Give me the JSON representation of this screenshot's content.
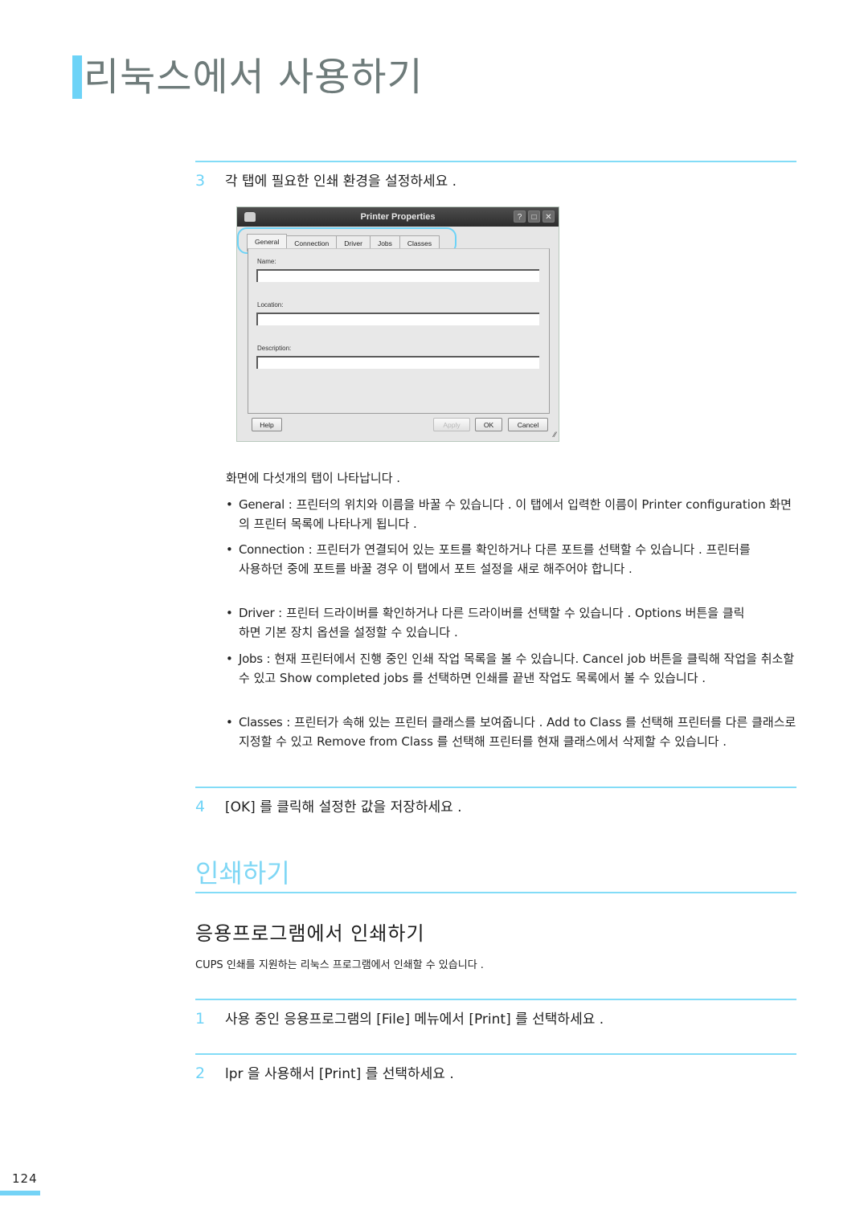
{
  "header": {
    "title": "리눅스에서 사용하기"
  },
  "steps_section1": [
    {
      "num": "3",
      "text": "각 탭에 필요한 인쇄 환경을 설정하세요 ."
    },
    {
      "num": "4",
      "text": "[OK] 를 클릭해 설정한 값을 저장하세요 ."
    }
  ],
  "dialog": {
    "title": "Printer Properties",
    "controls": [
      "?",
      "□",
      "✕"
    ],
    "tabs": [
      "General",
      "Connection",
      "Driver",
      "Jobs",
      "Classes"
    ],
    "active_tab": "General",
    "fields": [
      {
        "label": "Name:",
        "value": ""
      },
      {
        "label": "Location:",
        "value": ""
      },
      {
        "label": "Description:",
        "value": ""
      }
    ],
    "buttons": {
      "help": "Help",
      "apply": "Apply",
      "ok": "OK",
      "cancel": "Cancel"
    }
  },
  "intro": "화면에 다섯개의 탭이 나타납니다 .",
  "bullets": [
    {
      "term": "General",
      "text": " : 프린터의 위치와 이름을 바꿀 수 있습니다 . 이 탭에서 입력한 이름이 Printer configuration 화면의 프린터 목록에 나타나게 됩니다 ."
    },
    {
      "term": "Connection",
      "text": " : 프린터가 연결되어 있는 포트를 확인하거나 다른 포트를 선택할 수 있습니다 . 프린터를 사용하던 중에 포트를 바꿀 경우 이 탭에서 포트 설정을 새로 해주어야 합니다 ."
    },
    {
      "term": "Driver",
      "text": " : 프린터 드라이버를 확인하거나 다른 드라이버를 선택할 수 있습니다 . Options 버튼을 클릭하면 기본 장치 옵션을 설정할 수 있습니다 ."
    },
    {
      "term": "Jobs",
      "text": " : 현재 프린터에서 진행 중인 인쇄 작업 목록을 볼 수 있습니다. Cancel job 버튼을 클릭해 작업을 취소할 수 있고 Show completed jobs 를 선택하면 인쇄를 끝낸 작업도 목록에서 볼 수 있습니다 ."
    },
    {
      "term": "Classes",
      "text": " : 프린터가 속해 있는 프린터 클래스를 보여줍니다 . Add to Class 를 선택해 프린터를 다른 클래스로 지정할 수 있고 Remove from Class 를 선택해 프린터를 현재 클래스에서 삭제할 수 있습니다 ."
    }
  ],
  "print_section": {
    "title": "인쇄하기",
    "subtitle": "응용프로그램에서 인쇄하기",
    "description": "CUPS 인쇄를 지원하는 리눅스 프로그램에서 인쇄할 수 있습니다 .",
    "steps": [
      {
        "num": "1",
        "text": "사용 중인 응용프로그램의 [File] 메뉴에서 [Print] 를 선택하세요 ."
      },
      {
        "num": "2",
        "text": "lpr 을 사용해서 [Print] 를 선택하세요 ."
      }
    ]
  },
  "footer": {
    "page_number": "124"
  },
  "colors": {
    "accent": "#6dd3f7",
    "title_gray": "#6e7b7a"
  }
}
